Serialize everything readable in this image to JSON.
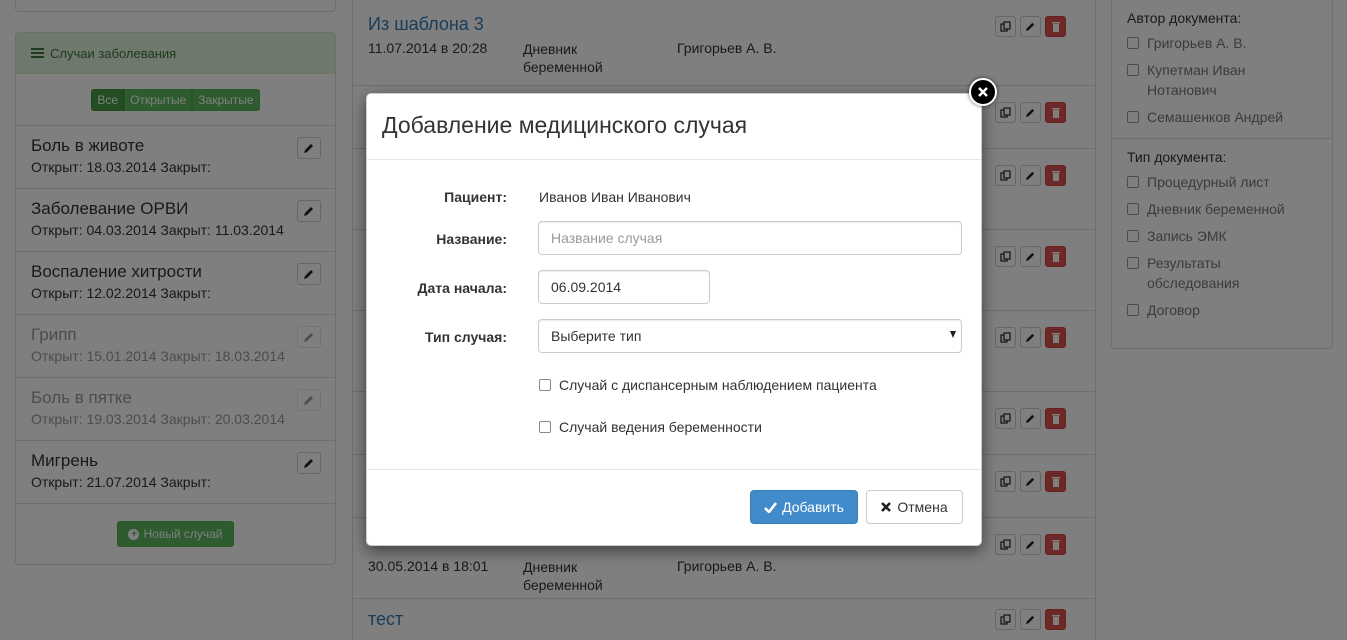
{
  "sidebar": {
    "panel_title": "Случаи заболевания",
    "filters": [
      "Все",
      "Открытые",
      "Закрытые"
    ],
    "cases": [
      {
        "title": "Боль в животе",
        "dates": "Открыт: 18.03.2014 Закрыт:"
      },
      {
        "title": "Заболевание ОРВИ",
        "dates": "Открыт: 04.03.2014 Закрыт: 11.03.2014"
      },
      {
        "title": "Воспаление хитрости",
        "dates": "Открыт: 12.02.2014 Закрыт:"
      },
      {
        "title": "Грипп",
        "dates": "Открыт: 15.01.2014 Закрыт: 18.03.2014"
      },
      {
        "title": "Боль в пятке",
        "dates": "Открыт: 19.03.2014 Закрыт: 20.03.2014"
      },
      {
        "title": "Мигрень",
        "dates": "Открыт: 21.07.2014 Закрыт:"
      }
    ],
    "new_case_label": "Новый случай"
  },
  "documents": [
    {
      "title": "Из шаблона 3",
      "date": "11.07.2014 в 20:28",
      "type": "Дневник беременной",
      "author": "Григорьев А. В."
    },
    {
      "date": "30.05.2014 в 18:01",
      "type": "Дневник беременной",
      "author": "Григорьев А. В."
    },
    {
      "title": "тест"
    }
  ],
  "filters_panel": {
    "author_title": "Автор документа:",
    "authors": [
      "Григорьев А. В.",
      "Купетман Иван Нотанович",
      "Семашенков Андрей"
    ],
    "type_title": "Тип документа:",
    "types": [
      "Процедурный лист",
      "Дневник беременной",
      "Запись ЭМК",
      "Результаты обследования",
      "Договор"
    ]
  },
  "modal": {
    "title": "Добавление медицинского случая",
    "patient_label": "Пациент:",
    "patient_value": "Иванов Иван Иванович",
    "name_label": "Название:",
    "name_placeholder": "Название случая",
    "start_label": "Дата начала:",
    "start_value": "06.09.2014",
    "type_label": "Тип случая:",
    "type_value": "Выберите тип",
    "check_dispensary": "Случай с диспансерным наблюдением пациента",
    "check_pregnancy": "Случай ведения беременности",
    "add_label": "Добавить",
    "cancel_label": "Отмена"
  },
  "colors": {
    "primary": "#428bca",
    "success": "#5cb85c",
    "danger": "#d9534f",
    "link": "#337ab7",
    "panel_success_bg": "#dff0d8"
  }
}
